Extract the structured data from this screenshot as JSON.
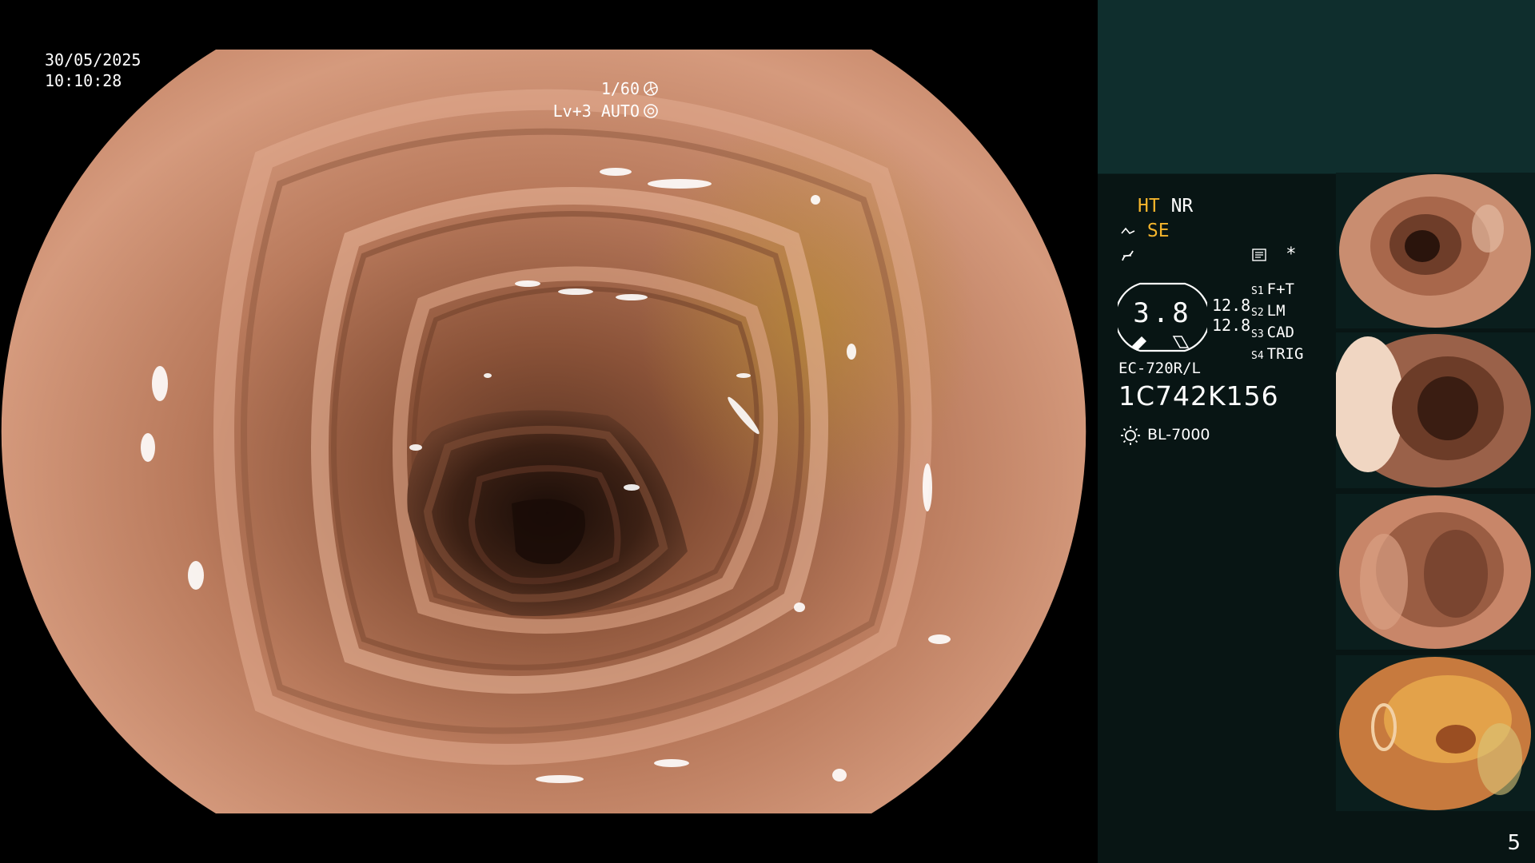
{
  "overlay": {
    "date": "30/05/2025",
    "time": "10:10:28",
    "shutter": "1/60",
    "level_mode": "Lv+3 AUTO"
  },
  "panel": {
    "ht": "HT",
    "nr": "NR",
    "se": "SE",
    "memo_star": "*",
    "gauge_value": "3.8",
    "gauge_side": [
      "12.8",
      "12.8"
    ],
    "switches": [
      {
        "label": "S1",
        "value": "F+T"
      },
      {
        "label": "S2",
        "value": "LM"
      },
      {
        "label": "S3",
        "value": "CAD"
      },
      {
        "label": "S4",
        "value": "TRIG"
      }
    ],
    "scope_model": "EC-720R/L",
    "scope_serial": "1C742K156",
    "light_source": "BL-7000"
  },
  "page_number": "5",
  "colors": {
    "panel_bg": "#081514",
    "panel_top": "#0f2e2d",
    "accent_yellow": "#f5b52c",
    "mucosa": "#c9876a"
  },
  "icons": [
    "aperture-icon",
    "exposure-icon",
    "structure-enhance-icon",
    "color-enhance-icon",
    "memo-icon",
    "light-source-icon"
  ]
}
